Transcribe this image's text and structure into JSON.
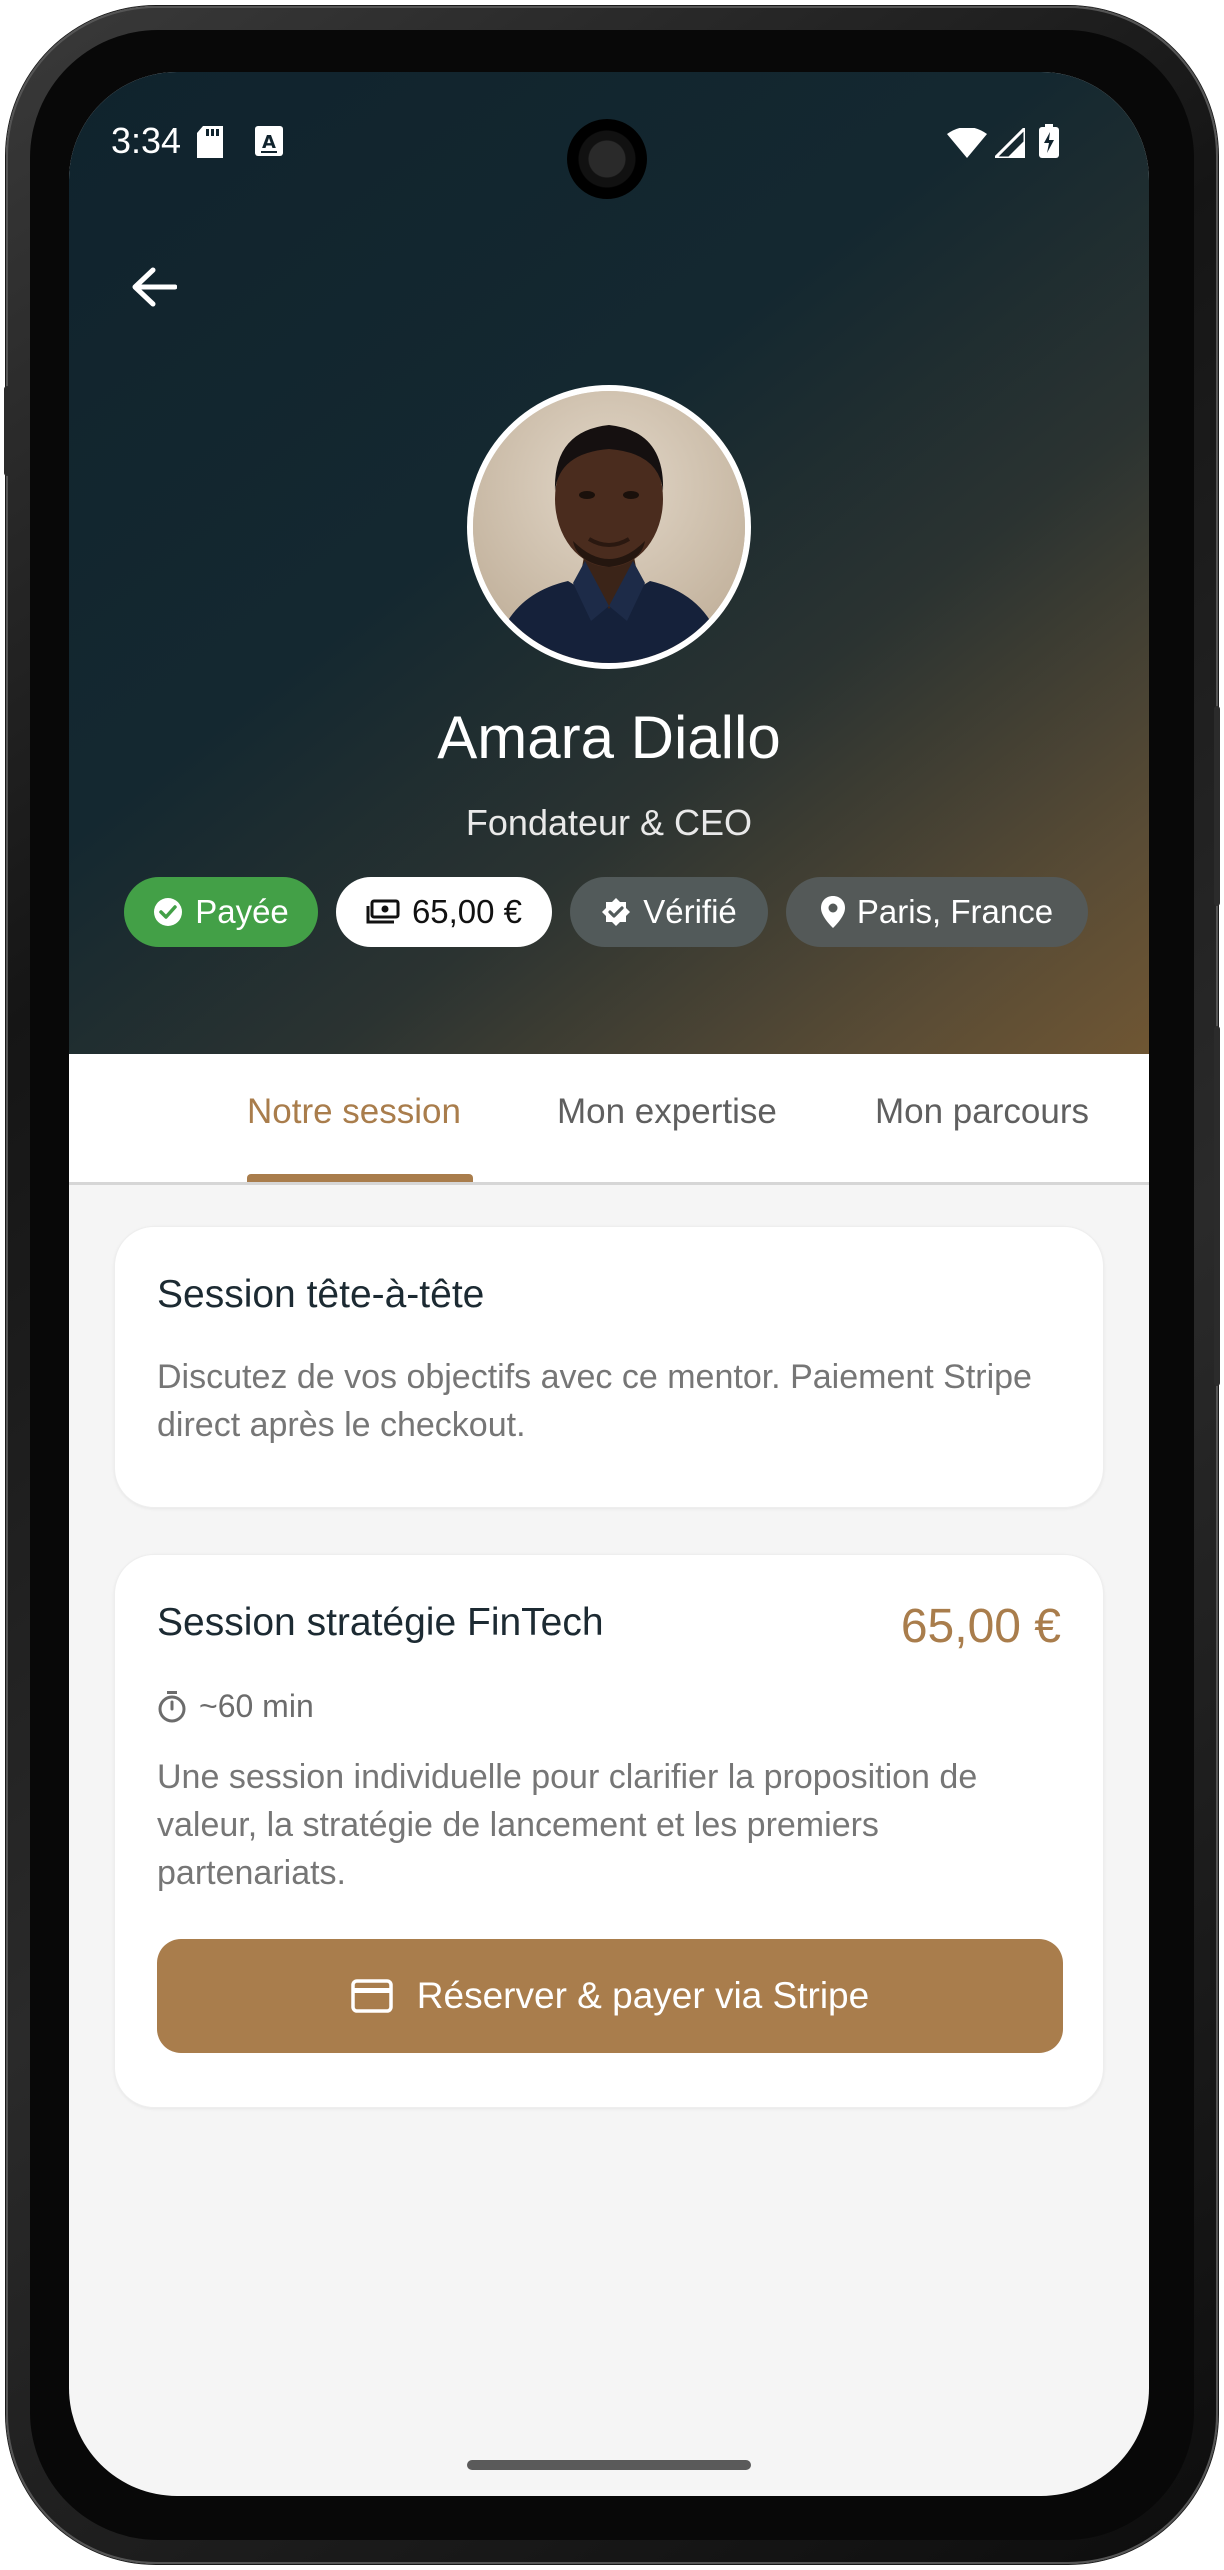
{
  "status_bar": {
    "time": "3:34",
    "icons": [
      "sd-card-icon",
      "keyboard-a-icon",
      "wifi-icon",
      "signal-icon",
      "battery-charging-icon"
    ]
  },
  "profile": {
    "name": "Amara Diallo",
    "role": "Fondateur & CEO",
    "chips": {
      "paid": "Payée",
      "price": "65,00 €",
      "verified": "Vérifié",
      "location": "Paris, France"
    }
  },
  "tabs": [
    {
      "label": "Notre session",
      "active": true
    },
    {
      "label": "Mon expertise",
      "active": false
    },
    {
      "label": "Mon parcours",
      "active": false
    }
  ],
  "intro_card": {
    "title": "Session tête-à-tête",
    "text": "Discutez de vos objectifs avec ce mentor. Paiement Stripe direct après le checkout."
  },
  "offer_card": {
    "title": "Session stratégie FinTech",
    "price": "65,00 €",
    "duration": "~60 min",
    "description": "Une session individuelle pour clarifier la proposition de valeur, la stratégie de lancement et les premiers partenariats.",
    "button_label": "Réserver & payer via Stripe"
  },
  "colors": {
    "accent": "#a97d4c",
    "paid_green": "#43a047",
    "hero_dark": "#10232d",
    "hero_warm": "#6f5633"
  }
}
